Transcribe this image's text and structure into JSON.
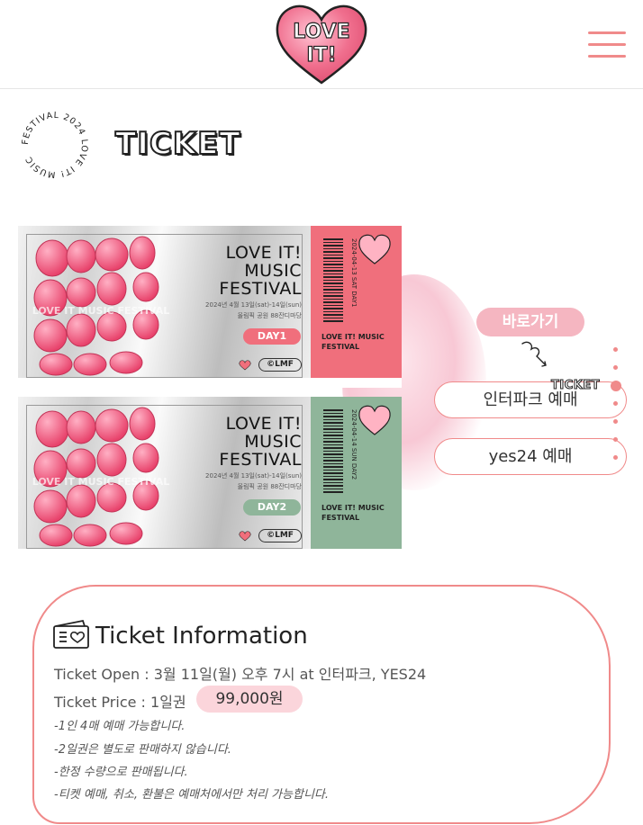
{
  "header": {
    "logo_text": "LOVE IT!",
    "menu_icon": "hamburger-icon"
  },
  "section": {
    "ring_text": "FESTIVAL 2024 LOVE IT! MUSIC",
    "title": "TICKET"
  },
  "tickets": [
    {
      "art_text": "LOVE IT MUSIC FESTIVAL",
      "title_line1": "LOVE IT!",
      "title_line2": "MUSIC",
      "title_line3": "FESTIVAL",
      "date_line1": "2024년 4월 13일(sat)-14일(sun)",
      "date_line2": "올림픽 공원 88잔디마당",
      "day": "DAY1",
      "lmf": "©LMF",
      "stub_vertical": "2024-04-13 SAT DAY1",
      "stub_small": "LOVE IT! MUSIC FESTIVAL"
    },
    {
      "art_text": "LOVE IT MUSIC FESTIVAL",
      "title_line1": "LOVE IT!",
      "title_line2": "MUSIC",
      "title_line3": "FESTIVAL",
      "date_line1": "2024년 4월 13일(sat)-14일(sun)",
      "date_line2": "올림픽 공원 88잔디마당",
      "day": "DAY2",
      "lmf": "©LMF",
      "stub_vertical": "2024-04-14 SUN DAY2",
      "stub_small": "LOVE IT! MUSIC FESTIVAL"
    }
  ],
  "shortcut": {
    "label": "바로가기",
    "interpark": "인터파크 예매",
    "yes24": "yes24 예매"
  },
  "dotnav": {
    "active_label": "TICKET",
    "count": 7,
    "active_index": 2
  },
  "info": {
    "title": "Ticket Information",
    "open_line": "Ticket Open : 3월 11일(월) 오후 7시 at 인터파크, YES24",
    "price_line": "Ticket Price : 1일권",
    "price": "99,000원",
    "notes": [
      "-1인 4매 예매 가능합니다.",
      "-2일권은 별도로 판매하지 않습니다.",
      "-한정 수량으로 판매됩니다.",
      "-티켓 예매, 취소, 환불은 예매처에서만 처리 가능합니다."
    ]
  },
  "colors": {
    "accent": "#f08a8a",
    "day1": "#f06f7c",
    "day2": "#8fb59a",
    "pill": "#f5b6c1"
  }
}
